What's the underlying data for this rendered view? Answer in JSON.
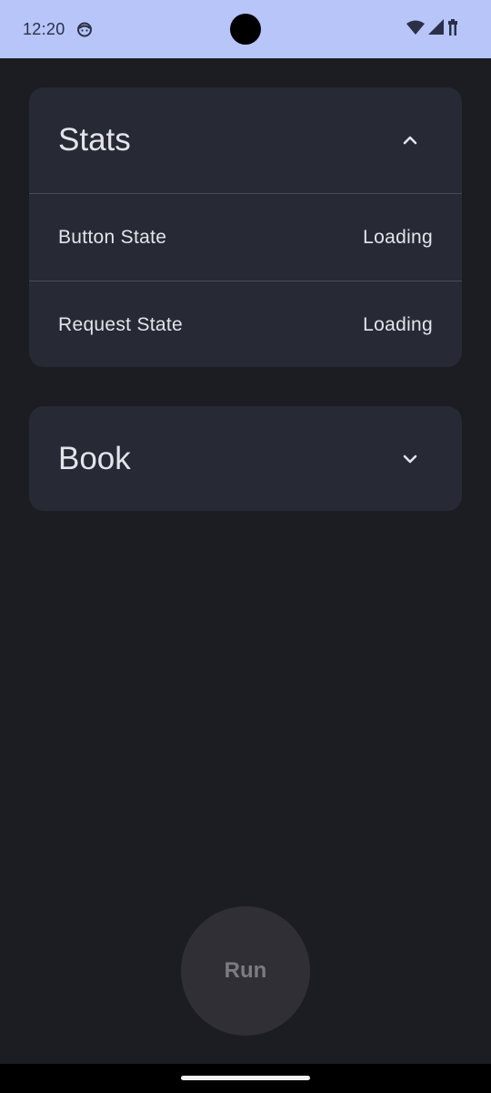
{
  "status_bar": {
    "time": "12:20",
    "background": "#b7c5f9",
    "icons": [
      "notification-face-icon",
      "wifi-icon",
      "signal-icon",
      "battery-icon"
    ]
  },
  "stats_card": {
    "title": "Stats",
    "expanded": true,
    "chevron_icon": "chevron-up-icon",
    "rows": [
      {
        "label": "Button State",
        "value": "Loading"
      },
      {
        "label": "Request State",
        "value": "Loading"
      }
    ]
  },
  "book_card": {
    "title": "Book",
    "expanded": false,
    "chevron_icon": "chevron-down-icon"
  },
  "run_button": {
    "label": "Run",
    "enabled": false
  },
  "colors": {
    "background": "#1c1d22",
    "card": "#272a34",
    "text": "#e4e4ec",
    "divider": "#484b56",
    "run_button_bg": "#302f35",
    "run_button_text": "#7c7b83"
  }
}
